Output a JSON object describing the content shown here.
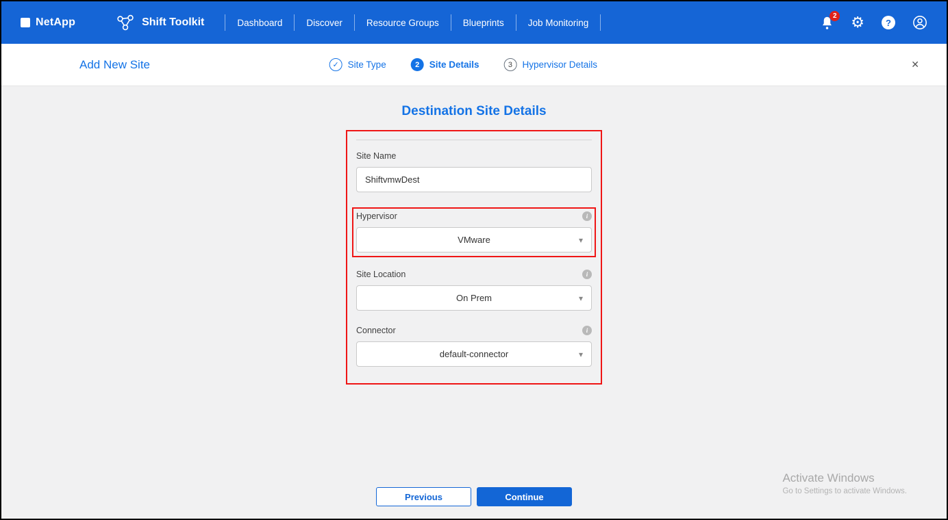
{
  "colors": {
    "header_bg": "#1565d6",
    "accent_blue": "#1473e6",
    "button_blue": "#1366d6",
    "annotation_red": "#ef1515"
  },
  "icons": {
    "gear_icon": "⚙",
    "help_icon": "?",
    "close_icon": "✕",
    "check_icon": "✓",
    "caret_down_icon": "▾",
    "info_icon": "i"
  },
  "header": {
    "brand": "NetApp",
    "app_name": "Shift Toolkit",
    "nav": [
      {
        "label": "Dashboard"
      },
      {
        "label": "Discover"
      },
      {
        "label": "Resource Groups"
      },
      {
        "label": "Blueprints"
      },
      {
        "label": "Job Monitoring"
      }
    ],
    "notifications": {
      "count": "2"
    }
  },
  "subheader": {
    "title": "Add New Site",
    "steps": [
      {
        "number": "",
        "label": "Site Type",
        "state": "done"
      },
      {
        "number": "2",
        "label": "Site Details",
        "state": "active"
      },
      {
        "number": "3",
        "label": "Hypervisor Details",
        "state": "todo"
      }
    ]
  },
  "main": {
    "title": "Destination Site Details",
    "form": {
      "site_name": {
        "label": "Site Name",
        "value": "ShiftvmwDest"
      },
      "hypervisor": {
        "label": "Hypervisor",
        "value": "VMware"
      },
      "site_location": {
        "label": "Site Location",
        "value": "On Prem"
      },
      "connector": {
        "label": "Connector",
        "value": "default-connector"
      }
    },
    "buttons": {
      "previous": "Previous",
      "continue": "Continue"
    },
    "watermark": {
      "line1": "Activate Windows",
      "line2": "Go to Settings to activate Windows."
    }
  }
}
